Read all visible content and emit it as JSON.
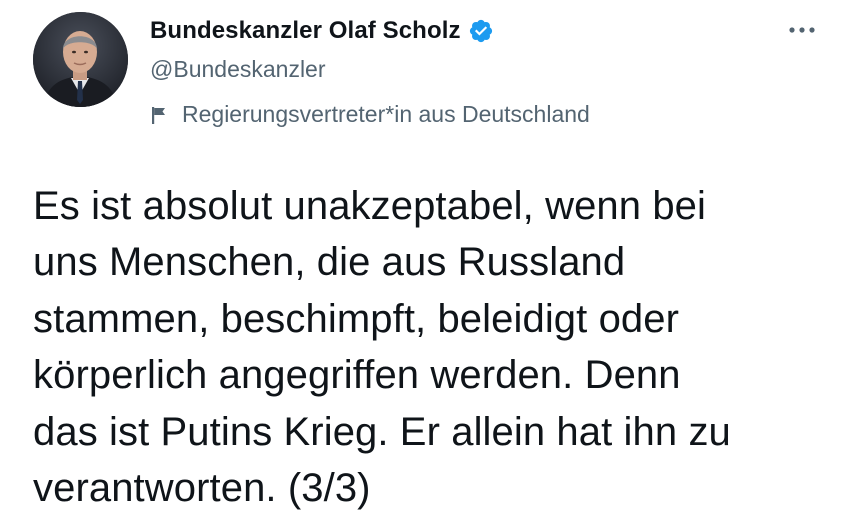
{
  "author": {
    "display_name": "Bundeskanzler Olaf Scholz",
    "handle": "@Bundeskanzler",
    "verified": true,
    "label": "Regierungsvertreter*in aus Deutschland",
    "avatar_icon": "profile-photo",
    "verified_icon": "verified-badge-icon",
    "label_icon": "flag-icon"
  },
  "tweet": {
    "text": "Es ist absolut unakzeptabel, wenn bei\nuns Menschen, die aus Russland\nstammen, beschimpft, beleidigt oder\nkörperlich angegriffen werden. Denn\ndas ist Putins Krieg. Er allein hat ihn zu\nverantworten. (3/3)"
  },
  "menu": {
    "icon": "more-options-icon"
  },
  "colors": {
    "text": "#0f1419",
    "secondary_text": "#536471",
    "verified_blue": "#1d9bf0",
    "background": "#ffffff"
  }
}
